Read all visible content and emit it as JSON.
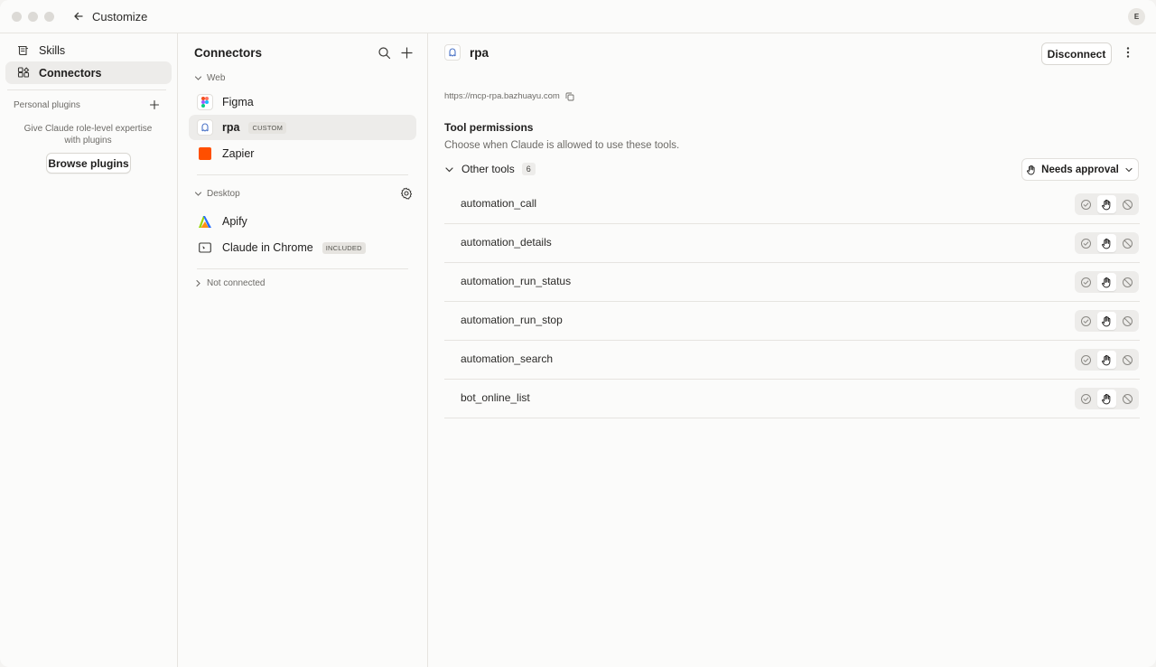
{
  "window": {
    "title": "Customize",
    "user_initial": "E"
  },
  "sidebar": {
    "items": [
      {
        "label": "Skills",
        "icon": "skills-icon"
      },
      {
        "label": "Connectors",
        "icon": "connectors-icon",
        "active": true
      }
    ],
    "plugins_label": "Personal plugins",
    "plugins_description": "Give Claude role-level expertise with plugins",
    "browse_button": "Browse plugins"
  },
  "connectors": {
    "title": "Connectors",
    "groups": [
      {
        "label": "Web",
        "items": [
          {
            "name": "Figma",
            "logo": "figma-logo"
          },
          {
            "name": "rpa",
            "badge": "CUSTOM",
            "logo": "rpa-logo",
            "active": true
          },
          {
            "name": "Zapier",
            "logo": "zapier-logo"
          }
        ]
      },
      {
        "label": "Desktop",
        "items": [
          {
            "name": "Apify",
            "logo": "apify-logo"
          },
          {
            "name": "Claude in Chrome",
            "badge": "INCLUDED",
            "logo": "chrome-extension-logo"
          }
        ]
      }
    ],
    "not_connected_label": "Not connected"
  },
  "detail": {
    "title": "rpa",
    "disconnect_button": "Disconnect",
    "url": "https://mcp-rpa.bazhuayu.com",
    "permissions_title": "Tool permissions",
    "permissions_subtitle": "Choose when Claude is allowed to use these tools.",
    "tools_group_label": "Other tools",
    "tools_count": "6",
    "approval_dropdown": "Needs approval",
    "tools": [
      {
        "name": "automation_call",
        "permission": "needs-approval"
      },
      {
        "name": "automation_details",
        "permission": "needs-approval"
      },
      {
        "name": "automation_run_status",
        "permission": "needs-approval"
      },
      {
        "name": "automation_run_stop",
        "permission": "needs-approval"
      },
      {
        "name": "automation_search",
        "permission": "needs-approval"
      },
      {
        "name": "bot_online_list",
        "permission": "needs-approval"
      }
    ]
  },
  "colors": {
    "background": "#fbfbfa",
    "active_row": "#edecea",
    "border": "#e6e4e0",
    "zapier": "#ff4f00",
    "rpa_accent": "#4a72c6"
  }
}
